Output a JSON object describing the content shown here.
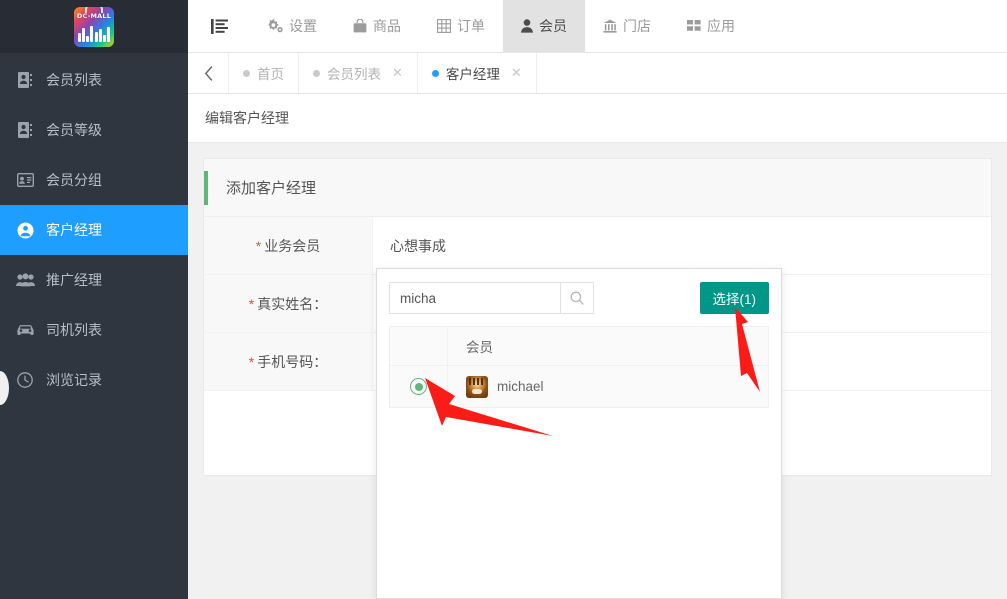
{
  "brand": {
    "logo_text": "DC-MALL"
  },
  "sidebar": {
    "items": [
      {
        "label": "会员列表",
        "icon": "contact-book-icon",
        "active": false
      },
      {
        "label": "会员等级",
        "icon": "contact-book-icon",
        "active": false
      },
      {
        "label": "会员分组",
        "icon": "id-card-icon",
        "active": false
      },
      {
        "label": "客户经理",
        "icon": "user-circle-icon",
        "active": true
      },
      {
        "label": "推广经理",
        "icon": "users-group-icon",
        "active": false
      },
      {
        "label": "司机列表",
        "icon": "car-icon",
        "active": false
      },
      {
        "label": "浏览记录",
        "icon": "clock-icon",
        "active": false
      }
    ]
  },
  "topnav": {
    "menu_icon": "list-menu-icon",
    "items": [
      {
        "label": "设置",
        "icon": "gears-icon",
        "active": false
      },
      {
        "label": "商品",
        "icon": "bag-icon",
        "active": false
      },
      {
        "label": "订单",
        "icon": "table-icon",
        "active": false
      },
      {
        "label": "会员",
        "icon": "user-icon",
        "active": true
      },
      {
        "label": "门店",
        "icon": "bank-icon",
        "active": false
      },
      {
        "label": "应用",
        "icon": "grid-icon",
        "active": false
      }
    ]
  },
  "tabs": {
    "back_icon": "chevron-left-icon",
    "items": [
      {
        "label": "首页",
        "closable": false,
        "active": false
      },
      {
        "label": "会员列表",
        "closable": true,
        "active": false
      },
      {
        "label": "客户经理",
        "closable": true,
        "active": true
      }
    ],
    "close_glyph": "✕"
  },
  "page": {
    "title": "编辑客户经理",
    "card_title": "添加客户经理"
  },
  "form": {
    "rows": [
      {
        "required": "*",
        "label": "业务会员",
        "value": "心想事成"
      },
      {
        "required": "*",
        "label": "真实姓名：",
        "value": ""
      },
      {
        "required": "*",
        "label": "手机号码：",
        "value": ""
      }
    ],
    "submit_label": ""
  },
  "picker": {
    "search_value": "micha",
    "search_placeholder": "",
    "search_icon": "search-icon",
    "select_button": "选择(1)",
    "column_header": "会员",
    "rows": [
      {
        "selected": true,
        "name": "michael",
        "avatar": "tiger-avatar"
      }
    ]
  },
  "colors": {
    "sidebar_bg": "#2f3640",
    "sidebar_active": "#1e9fff",
    "accent_green": "#5fb878",
    "select_button": "#009688",
    "primary_button": "#1e9fff",
    "arrow_red": "#fc1c17"
  }
}
